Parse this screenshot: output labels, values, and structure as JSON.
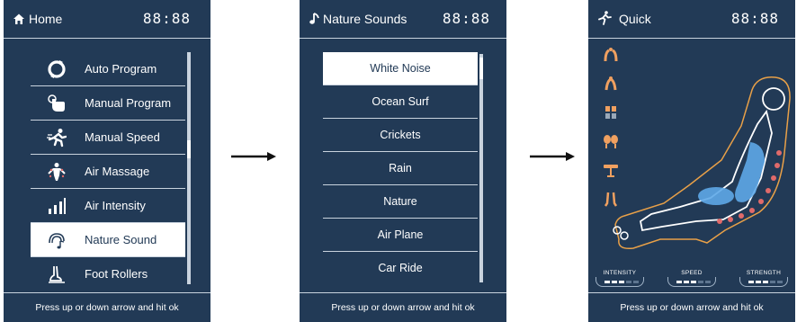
{
  "screens": [
    {
      "icon": "home-icon",
      "title": "Home",
      "clock": "88:88",
      "menu": [
        {
          "label": "Auto Program",
          "icon": "auto-program-icon"
        },
        {
          "label": "Manual Program",
          "icon": "manual-program-icon"
        },
        {
          "label": "Manual Speed",
          "icon": "manual-speed-icon"
        },
        {
          "label": "Air Massage",
          "icon": "air-massage-icon"
        },
        {
          "label": "Air Intensity",
          "icon": "air-intensity-icon"
        },
        {
          "label": "Nature Sound",
          "icon": "nature-sound-icon",
          "selected": true
        },
        {
          "label": "Foot Rollers",
          "icon": "foot-rollers-icon"
        }
      ],
      "footer": "Press up or down arrow and hit ok"
    },
    {
      "icon": "music-note-icon",
      "title": "Nature Sounds",
      "clock": "88:88",
      "list": [
        "White Noise",
        "Ocean Surf",
        "Crickets",
        "Rain",
        "Nature",
        "Air Plane",
        "Car Ride"
      ],
      "selected_index": 0,
      "footer": "Press up or down arrow and hit ok"
    },
    {
      "icon": "running-person-icon",
      "title": "Quick",
      "clock": "88:88",
      "side_icons": [
        "shoulder-icon",
        "back-icon",
        "waist-icon",
        "hip-icon",
        "seat-icon",
        "legs-icon"
      ],
      "gauges": [
        {
          "label": "INTENSITY",
          "level": 3,
          "max": 5
        },
        {
          "label": "SPEED",
          "level": 3,
          "max": 5
        },
        {
          "label": "STRENGTH",
          "level": 3,
          "max": 5
        }
      ],
      "footer": "Press up or down arrow and hit ok"
    }
  ],
  "colors": {
    "screen_bg": "#223a56",
    "text": "#ffffff",
    "divider": "#c9d3de",
    "chair_outline": "#e8a048",
    "highlight_blue": "#5ea8e8",
    "massage_dot": "#e06a6a"
  }
}
